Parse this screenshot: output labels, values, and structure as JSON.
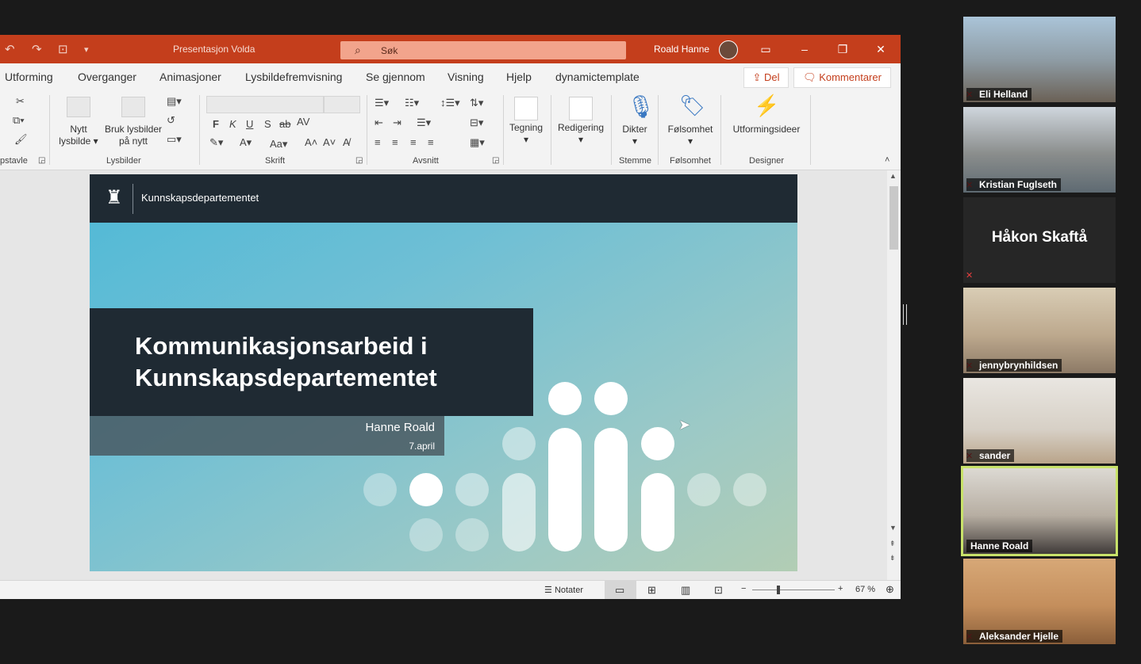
{
  "window": {
    "doc_title": "Presentasjon Volda",
    "search_placeholder": "Søk",
    "user_name": "Roald Hanne"
  },
  "menu": {
    "tabs": [
      "Utforming",
      "Overganger",
      "Animasjoner",
      "Lysbildefremvisning",
      "Se gjennom",
      "Visning",
      "Hjelp",
      "dynamictemplate"
    ],
    "share_label": "Del",
    "comment_label": "Kommentarer"
  },
  "ribbon": {
    "groups": {
      "clipboard": "pstavle",
      "slides": "Lysbilder",
      "font": "Skrift",
      "paragraph": "Avsnitt",
      "voice": "Stemme",
      "sensitivity": "Følsomhet",
      "designer": "Designer"
    },
    "buttons": {
      "new_slide_1": "Nytt",
      "new_slide_2": "lysbilde",
      "reuse_1": "Bruk lysbilder",
      "reuse_2": "på nytt",
      "drawing": "Tegning",
      "editing": "Redigering",
      "dictate": "Dikter",
      "sensitivity": "Følsomhet",
      "design_ideas": "Utformingsideer"
    },
    "font_letters": [
      "F",
      "K",
      "U",
      "S",
      "ab",
      "AV"
    ]
  },
  "slide": {
    "org": "Kunnskapsdepartementet",
    "title_line1": "Kommunikasjonsarbeid i",
    "title_line2": "Kunnskapsdepartementet",
    "presenter": "Hanne Roald",
    "date": "7.april"
  },
  "status": {
    "notes_label": "Notater",
    "zoom": "67 %"
  },
  "participants": [
    {
      "name": "Eli Helland",
      "type": "video",
      "active": false
    },
    {
      "name": "Kristian Fuglseth",
      "type": "video",
      "active": false
    },
    {
      "name": "Håkon Skaftå",
      "type": "name-only",
      "active": false
    },
    {
      "name": "jennybrynhildsen",
      "type": "video",
      "active": false
    },
    {
      "name": "sander",
      "type": "video",
      "active": false
    },
    {
      "name": "Hanne Roald",
      "type": "video",
      "active": true
    },
    {
      "name": "Aleksander Hjelle",
      "type": "video",
      "active": false
    }
  ],
  "colors": {
    "titlebar": "#c43e1c",
    "slide_dark": "#1f2a33",
    "active_speaker": "#c8e26a"
  }
}
